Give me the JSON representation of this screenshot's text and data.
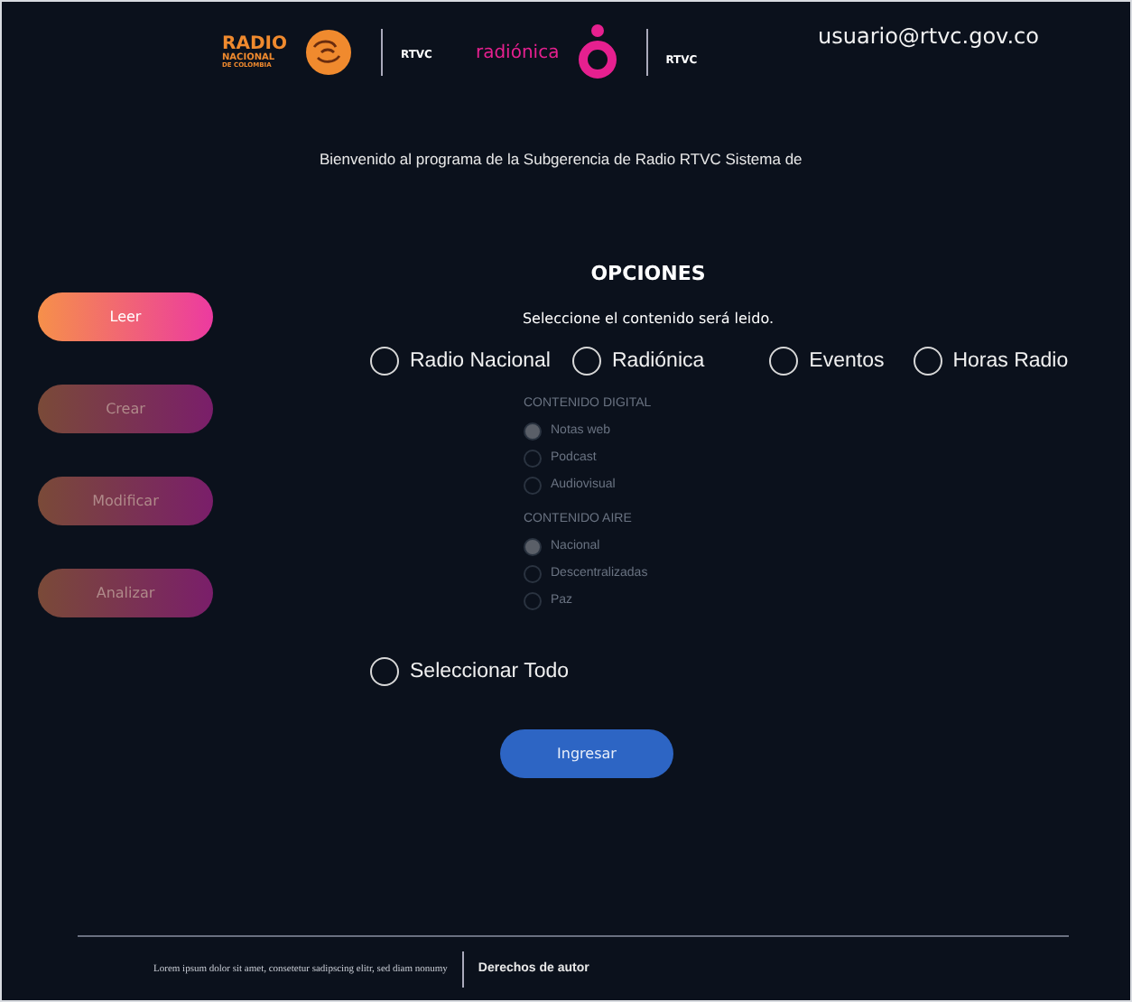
{
  "header": {
    "logos": [
      {
        "kind": "radio-nacional",
        "lines": [
          "RADIO",
          "NACIONAL",
          "DE COLOMBIA"
        ],
        "tag": "RTVC"
      },
      {
        "kind": "radionica",
        "name": "radiónica",
        "tag": "RTVC"
      }
    ],
    "user": "usuario@rtvc.gov.co"
  },
  "welcome": "Bienvenido al programa de la Subgerencia de Radio RTVC Sistema de",
  "sidebar": {
    "items": [
      {
        "label": "Leer",
        "selected": true
      },
      {
        "label": "Crear",
        "selected": false
      },
      {
        "label": "Modificar",
        "selected": false
      },
      {
        "label": "Analizar",
        "selected": false
      }
    ]
  },
  "options": {
    "title": "OPCIONES",
    "subtitle": "Seleccione el contenido será leido.",
    "channels": [
      {
        "label": "Radio Nacional",
        "selected": false
      },
      {
        "label": "Radiónica",
        "selected": false
      },
      {
        "label": "Eventos",
        "selected": false
      },
      {
        "label": "Horas Radio",
        "selected": false
      }
    ],
    "groups": [
      {
        "title": "CONTENIDO DIGITAL",
        "disabled": true,
        "items": [
          {
            "label": "Notas web",
            "selected": true
          },
          {
            "label": "Podcast",
            "selected": false
          },
          {
            "label": "Audiovisual",
            "selected": false
          }
        ]
      },
      {
        "title": "CONTENIDO AIRE",
        "disabled": true,
        "items": [
          {
            "label": "Nacional",
            "selected": true
          },
          {
            "label": "Descentralizadas",
            "selected": false
          },
          {
            "label": "Paz",
            "selected": false
          }
        ]
      }
    ],
    "select_all": {
      "label": "Seleccionar Todo",
      "selected": false
    },
    "submit": "Ingresar"
  },
  "footer": {
    "text": "Lorem ipsum dolor sit amet, consetetur sadipscing elitr, sed diam nonumy",
    "link": "Derechos de autor"
  }
}
